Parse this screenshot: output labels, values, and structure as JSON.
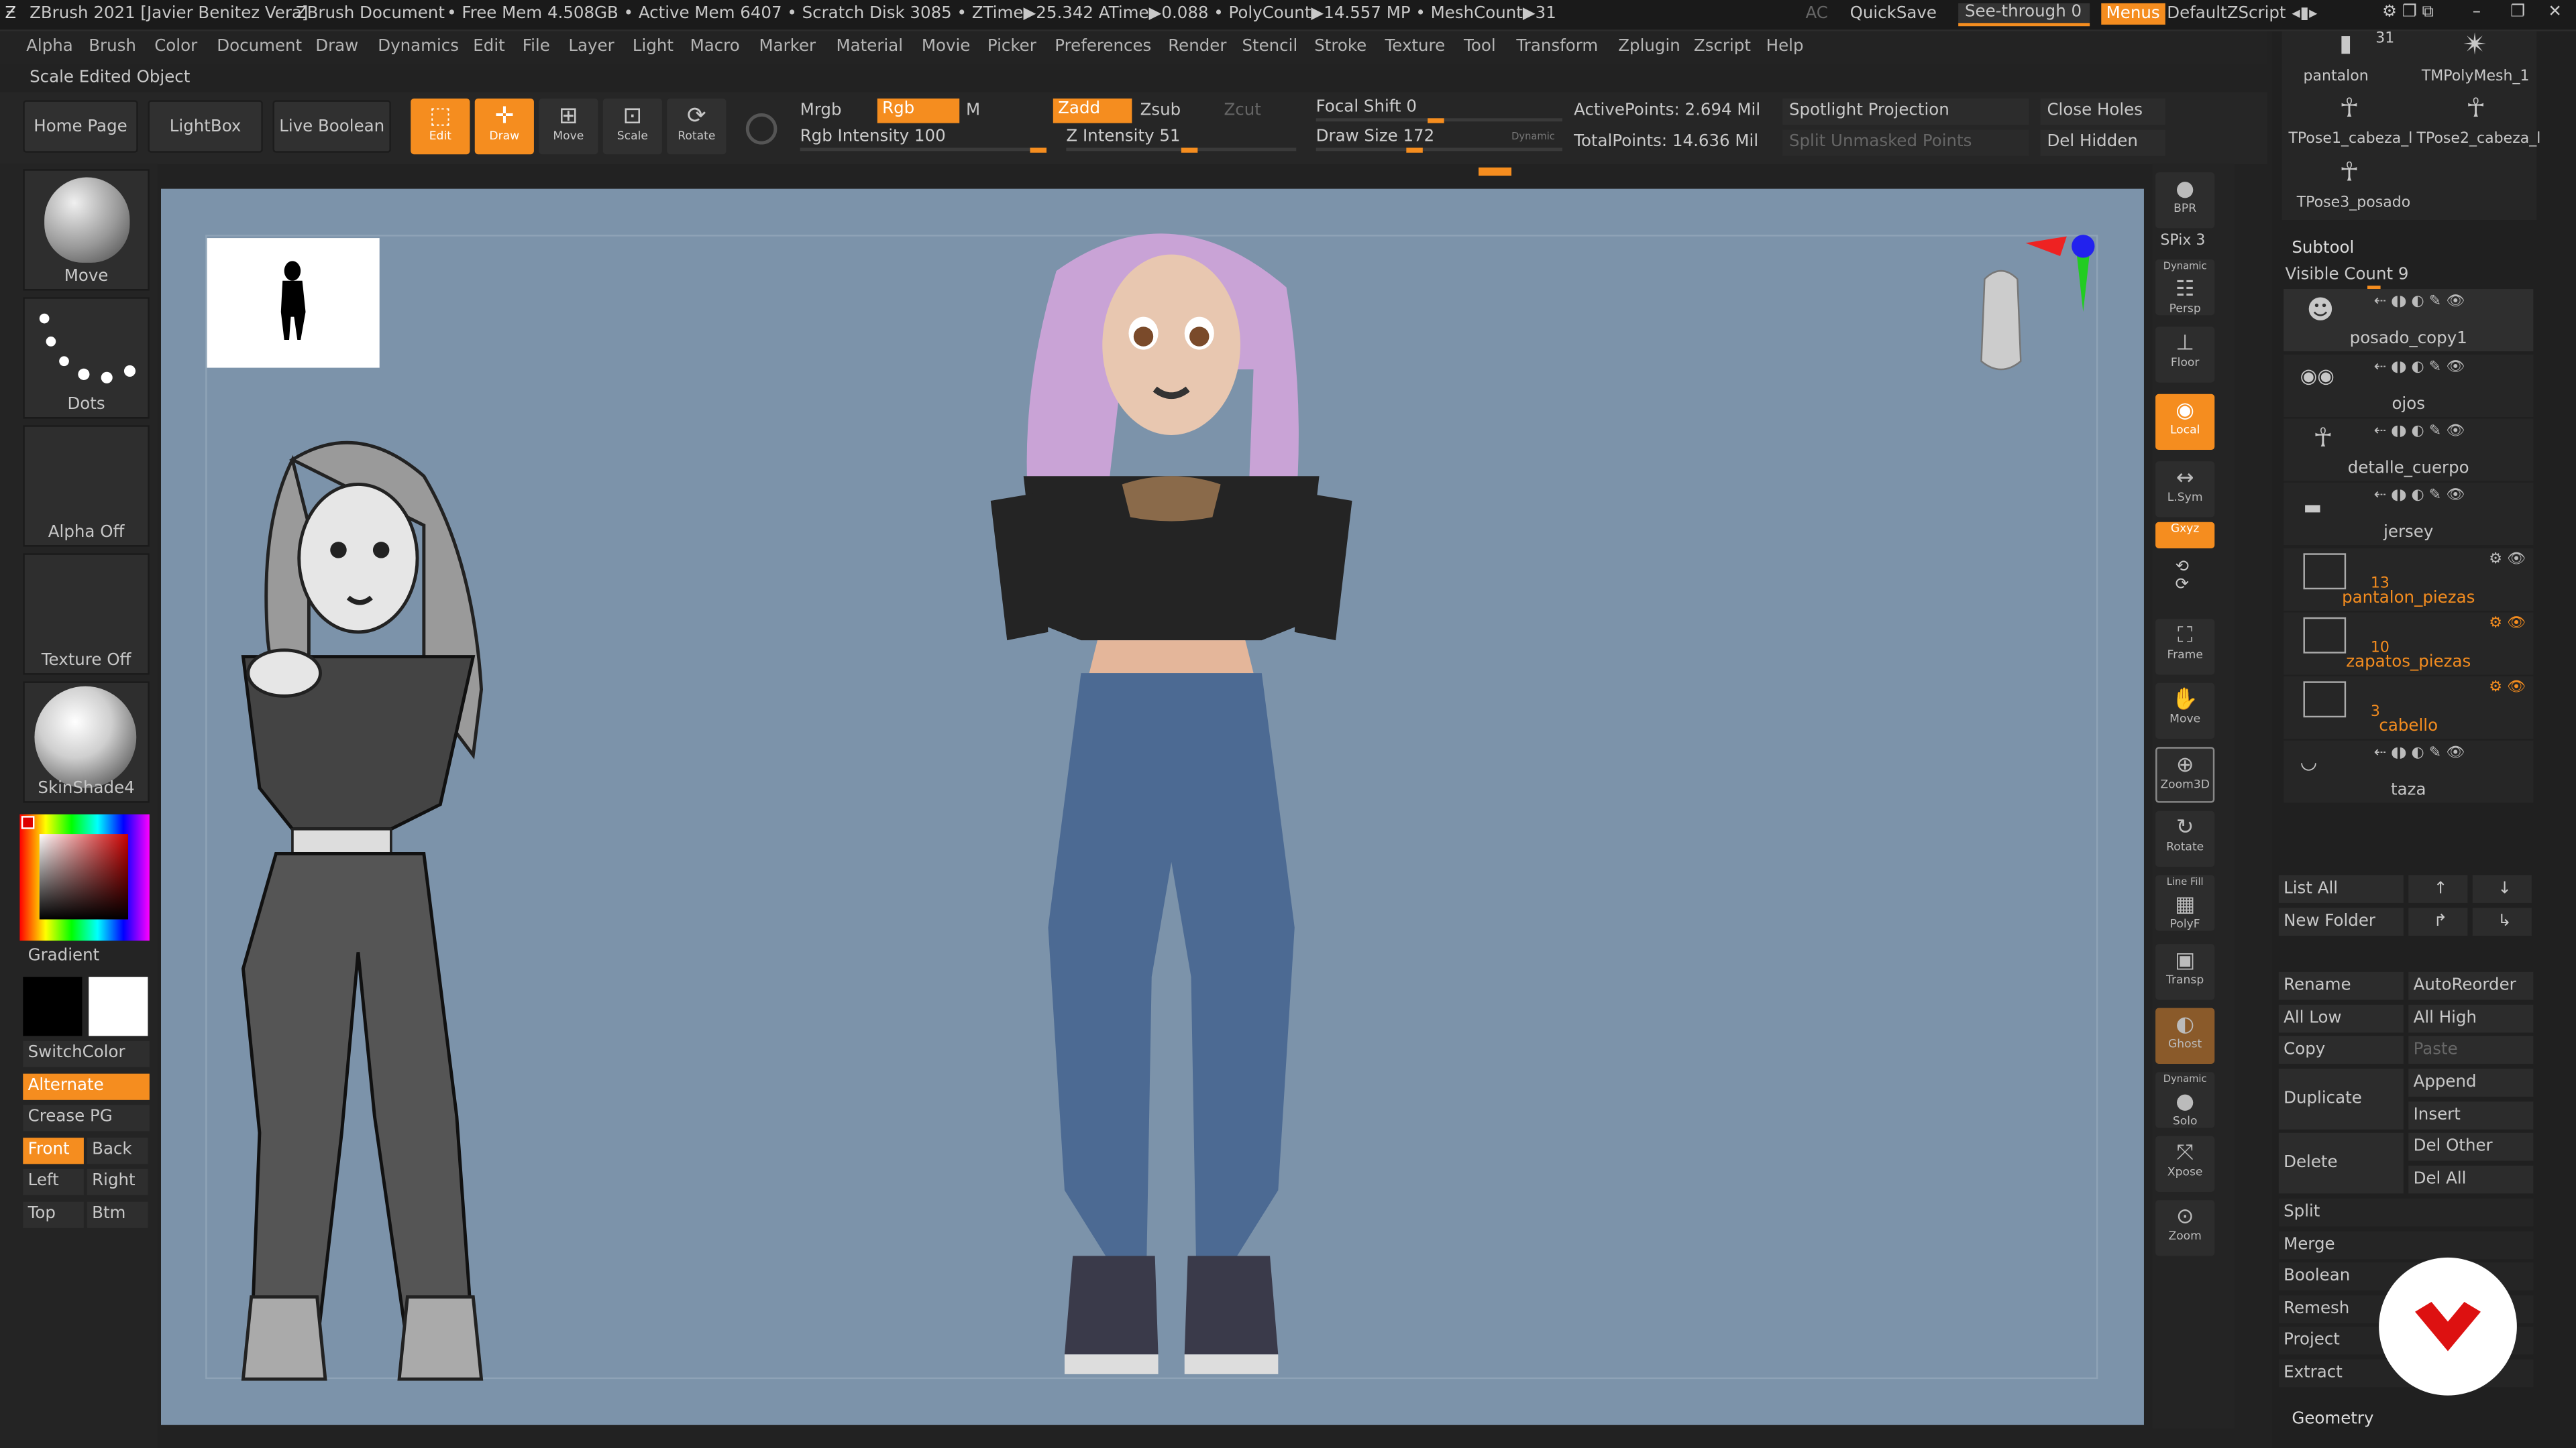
{
  "titlebar": {
    "app": "ZBrush 2021 [Javier Benitez Vera]",
    "document": "ZBrush Document",
    "stats": "• Free Mem 4.508GB • Active Mem 6407 • Scratch Disk 3085 • ZTime▶25.342 ATime▶0.088 • PolyCount▶14.557 MP • MeshCount▶31",
    "ac": "AC",
    "quicksave": "QuickSave",
    "seethrough": "See-through 0",
    "menus": "Menus",
    "defaultzscript": "DefaultZScript"
  },
  "menus": [
    "Alpha",
    "Brush",
    "Color",
    "Document",
    "Draw",
    "Dynamics",
    "Edit",
    "File",
    "Layer",
    "Light",
    "Macro",
    "Marker",
    "Material",
    "Movie",
    "Picker",
    "Preferences",
    "Render",
    "Stencil",
    "Stroke",
    "Texture",
    "Tool",
    "Transform",
    "Zplugin",
    "Zscript",
    "Help"
  ],
  "status_text": "Scale Edited Object",
  "shelf": {
    "home": "Home Page",
    "lightbox": "LightBox",
    "liveboolean": "Live Boolean",
    "edit": "Edit",
    "draw": "Draw",
    "move": "Move",
    "scale": "Scale",
    "rotate": "Rotate",
    "mrgb": "Mrgb",
    "rgb": "Rgb",
    "m": "M",
    "rgb_intensity": "Rgb Intensity 100",
    "zadd": "Zadd",
    "zsub": "Zsub",
    "zcut": "Zcut",
    "z_intensity": "Z Intensity 51",
    "focal_shift": "Focal Shift 0",
    "draw_size": "Draw Size 172",
    "dynamic": "Dynamic",
    "active_points": "ActivePoints: 2.694 Mil",
    "total_points": "TotalPoints: 14.636 Mil",
    "spotlight": "Spotlight Projection",
    "split_unmasked": "Split Unmasked Points",
    "close_holes": "Close Holes",
    "del_hidden": "Del Hidden"
  },
  "leftpanel": {
    "move": "Move",
    "dots": "Dots",
    "alpha_off": "Alpha Off",
    "texture_off": "Texture Off",
    "skinshade": "SkinShade4",
    "gradient": "Gradient",
    "switchcolor": "SwitchColor",
    "alternate": "Alternate",
    "creasepg": "Crease PG",
    "front": "Front",
    "back": "Back",
    "left": "Left",
    "right": "Right",
    "top": "Top",
    "btm": "Btm"
  },
  "righttools": {
    "bpr": "BPR",
    "spix": "SPix 3",
    "persp": "Persp",
    "persp_top": "Dynamic",
    "floor": "Floor",
    "local": "Local",
    "lsym": "L.Sym",
    "xyz": "Gxyz",
    "frame": "Frame",
    "move": "Move",
    "zoom3d": "Zoom3D",
    "rotate": "Rotate",
    "polyf": "PolyF",
    "linefill": "Line Fill",
    "transp": "Transp",
    "ghost": "Ghost",
    "solo": "Solo",
    "solo_top": "Dynamic",
    "xpose": "Xpose",
    "zoom": "Zoom"
  },
  "tools": {
    "pantalon": "pantalon",
    "count": "31",
    "tmpoly": "TMPolyMesh_1",
    "tpose1": "TPose1_cabeza_l",
    "tpose2": "TPose2_cabeza_l",
    "tpose3": "TPose3_posado"
  },
  "subtool": {
    "header": "Subtool",
    "visible": "Visible Count 9",
    "items": [
      {
        "name": "posado_copy1"
      },
      {
        "name": "ojos"
      },
      {
        "name": "detalle_cuerpo"
      },
      {
        "name": "jersey"
      },
      {
        "name": "pantalon_piezas",
        "count": "13"
      },
      {
        "name": "zapatos_piezas",
        "count": "10"
      },
      {
        "name": "cabello",
        "count": "3"
      },
      {
        "name": "taza"
      }
    ],
    "list_all": "List All",
    "new_folder": "New Folder",
    "rename": "Rename",
    "autoreorder": "AutoReorder",
    "all_low": "All Low",
    "all_high": "All High",
    "copy": "Copy",
    "paste": "Paste",
    "duplicate": "Duplicate",
    "append": "Append",
    "insert": "Insert",
    "delete": "Delete",
    "del_other": "Del Other",
    "del_all": "Del All",
    "split": "Split",
    "merge": "Merge",
    "boolean": "Boolean",
    "remesh": "Remesh",
    "project": "Project",
    "extract": "Extract",
    "geometry": "Geometry"
  },
  "colors": {
    "accent": "#f58d1f",
    "viewport": "#7c93aa"
  }
}
